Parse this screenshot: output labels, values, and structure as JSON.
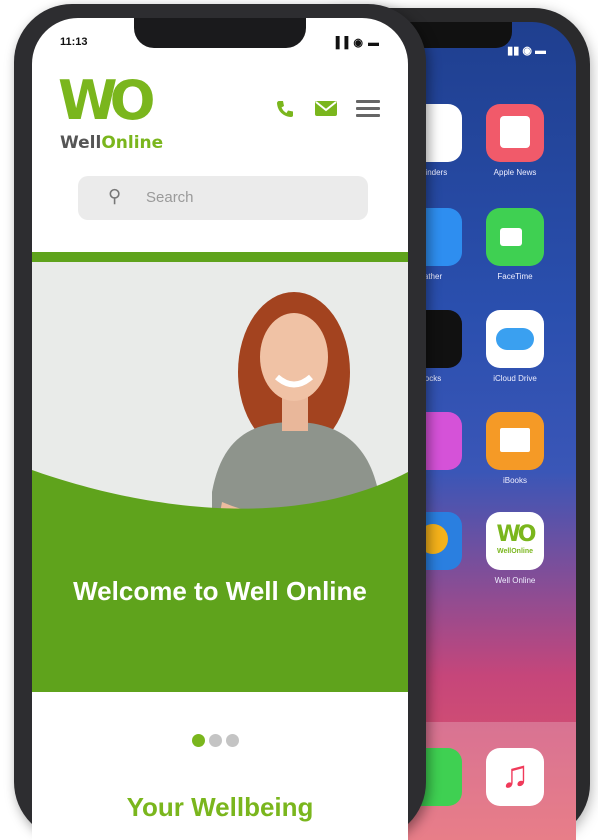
{
  "front": {
    "status": {
      "time": "11:13",
      "icons": "▐▐ ◉ ▬"
    },
    "brand": {
      "mark": "WO",
      "name_part1": "Well",
      "name_part2": "Online"
    },
    "search": {
      "placeholder": "Search"
    },
    "hero": {
      "title": "Welcome to Well Online"
    },
    "carousel": {
      "count": 3,
      "active": 1
    },
    "section": {
      "title": "Your Wellbeing"
    },
    "colors": {
      "brand_green": "#7ab61d",
      "hero_green": "#5fa31c"
    }
  },
  "back": {
    "apps": [
      {
        "label": "minders",
        "icon": "reminders-icon"
      },
      {
        "label": "Apple News",
        "icon": "news-icon"
      },
      {
        "label": "ather",
        "icon": "weather-icon"
      },
      {
        "label": "FaceTime",
        "icon": "facetime-icon"
      },
      {
        "label": "ocks",
        "icon": "stocks-icon"
      },
      {
        "label": "iCloud Drive",
        "icon": "icloud-icon"
      },
      {
        "label": "",
        "icon": "itunes-icon"
      },
      {
        "label": "iBooks",
        "icon": "books-icon"
      },
      {
        "label": "",
        "icon": "photos-icon"
      },
      {
        "label": "Well Online",
        "icon": "wellonline-app-icon",
        "mark": "WO",
        "sub": "WellOnline"
      }
    ]
  }
}
